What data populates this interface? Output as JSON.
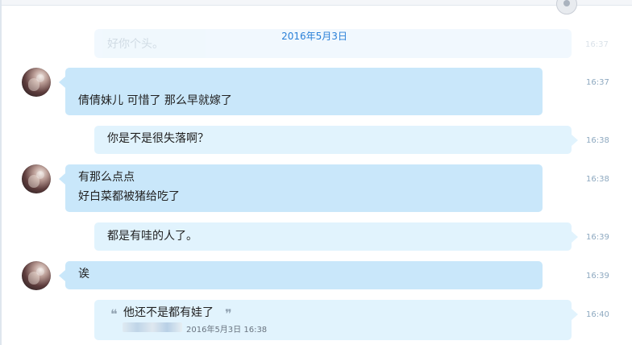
{
  "date_header": "2016年5月3日",
  "faded": {
    "text": "好你个头。",
    "time": "16:37"
  },
  "messages": [
    {
      "side": "left",
      "lines": [
        "倩倩妹儿 可惜了 那么早就嫁了"
      ],
      "time": "16:37"
    },
    {
      "side": "right",
      "lines": [
        "你是不是很失落啊？"
      ],
      "time": "16:38"
    },
    {
      "side": "left",
      "lines": [
        "有那么点点",
        "好白菜都被猪给吃了"
      ],
      "time": "16:38"
    },
    {
      "side": "right",
      "lines": [
        "都是有哇的人了。"
      ],
      "time": "16:39"
    },
    {
      "side": "left",
      "lines": [
        "诶"
      ],
      "time": "16:39"
    },
    {
      "side": "right",
      "quote": {
        "open": "❝",
        "text": "他还不是都有娃了",
        "close": "❞",
        "meta_date": "2016年5月3日 16:38"
      },
      "time": "16:40"
    }
  ]
}
